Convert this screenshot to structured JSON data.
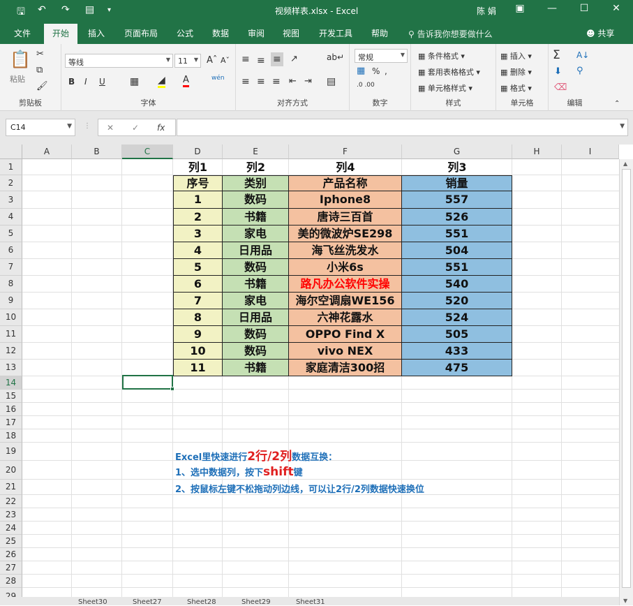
{
  "window": {
    "title": "视频样表.xlsx  -  Excel",
    "user": "陈 娟"
  },
  "quick_access": {
    "save_icon": "save-icon",
    "undo_icon": "undo-icon",
    "redo_icon": "redo-icon",
    "form_icon": "form-icon",
    "customize_icon": "customize-icon"
  },
  "tabs": [
    "文件",
    "开始",
    "插入",
    "页面布局",
    "公式",
    "数据",
    "审阅",
    "视图",
    "开发工具",
    "帮助"
  ],
  "active_tab": "开始",
  "tell_me": "告诉我你想要做什么",
  "share": "共享",
  "ribbon": {
    "clipboard": {
      "label": "剪贴板",
      "paste": "粘贴"
    },
    "font": {
      "label": "字体",
      "name": "等线",
      "size": "11",
      "bold": "B",
      "italic": "I",
      "underline": "U",
      "phonetic": "wén"
    },
    "alignment": {
      "label": "对齐方式"
    },
    "number": {
      "label": "数字",
      "format": "常规"
    },
    "styles": {
      "label": "样式",
      "conditional": "条件格式",
      "table": "套用表格格式",
      "cell": "单元格样式"
    },
    "cells": {
      "label": "单元格",
      "insert": "插入",
      "delete": "删除",
      "format": "格式"
    },
    "editing": {
      "label": "编辑"
    }
  },
  "formula_bar": {
    "name_box": "C14",
    "fx": "fx",
    "formula": ""
  },
  "columns": [
    "A",
    "B",
    "C",
    "D",
    "E",
    "F",
    "G",
    "H",
    "I"
  ],
  "selected_column": "C",
  "rows": [
    "1",
    "2",
    "3",
    "4",
    "5",
    "6",
    "7",
    "8",
    "9",
    "10",
    "11",
    "12",
    "13",
    "14",
    "15",
    "16",
    "17",
    "18",
    "19",
    "20",
    "21",
    "22",
    "23",
    "24",
    "25",
    "26",
    "27",
    "28",
    "29"
  ],
  "selected_row": "14",
  "table": {
    "col_titles": [
      "列1",
      "列2",
      "列4",
      "列3"
    ],
    "header": [
      "序号",
      "类别",
      "产品名称",
      "销量"
    ],
    "rows": [
      [
        "1",
        "数码",
        "Iphone8",
        "557"
      ],
      [
        "2",
        "书籍",
        "唐诗三百首",
        "526"
      ],
      [
        "3",
        "家电",
        "美的微波炉SE298",
        "551"
      ],
      [
        "4",
        "日用品",
        "海飞丝洗发水",
        "504"
      ],
      [
        "5",
        "数码",
        "小米6s",
        "551"
      ],
      [
        "6",
        "书籍",
        "路凡办公软件实操",
        "540"
      ],
      [
        "7",
        "家电",
        "海尔空调扇WE156",
        "520"
      ],
      [
        "8",
        "日用品",
        "六神花露水",
        "524"
      ],
      [
        "9",
        "数码",
        "OPPO Find X",
        "505"
      ],
      [
        "10",
        "数码",
        "vivo NEX",
        "433"
      ],
      [
        "11",
        "书籍",
        "家庭清洁300招",
        "475"
      ]
    ],
    "colors": {
      "seq": "#f2f2c4",
      "cat": "#c5e0b4",
      "name": "#f4c1a0",
      "sales": "#8fbfe0",
      "highlight_text": "#ff0000"
    }
  },
  "notes": {
    "line1_pre": "Excel里快速进行",
    "line1_em": "2行/2列",
    "line1_post": "数据互换：",
    "line2_pre": "1、选中数据列，按下",
    "line2_em": "shift",
    "line2_post": "键",
    "line3": "2、按鼠标左键不松拖动列边线，可以让2行/2列数据快速换位"
  },
  "sheet_tabs": [
    "Sheet30",
    "Sheet27",
    "Sheet28",
    "Sheet29",
    "Sheet31"
  ]
}
